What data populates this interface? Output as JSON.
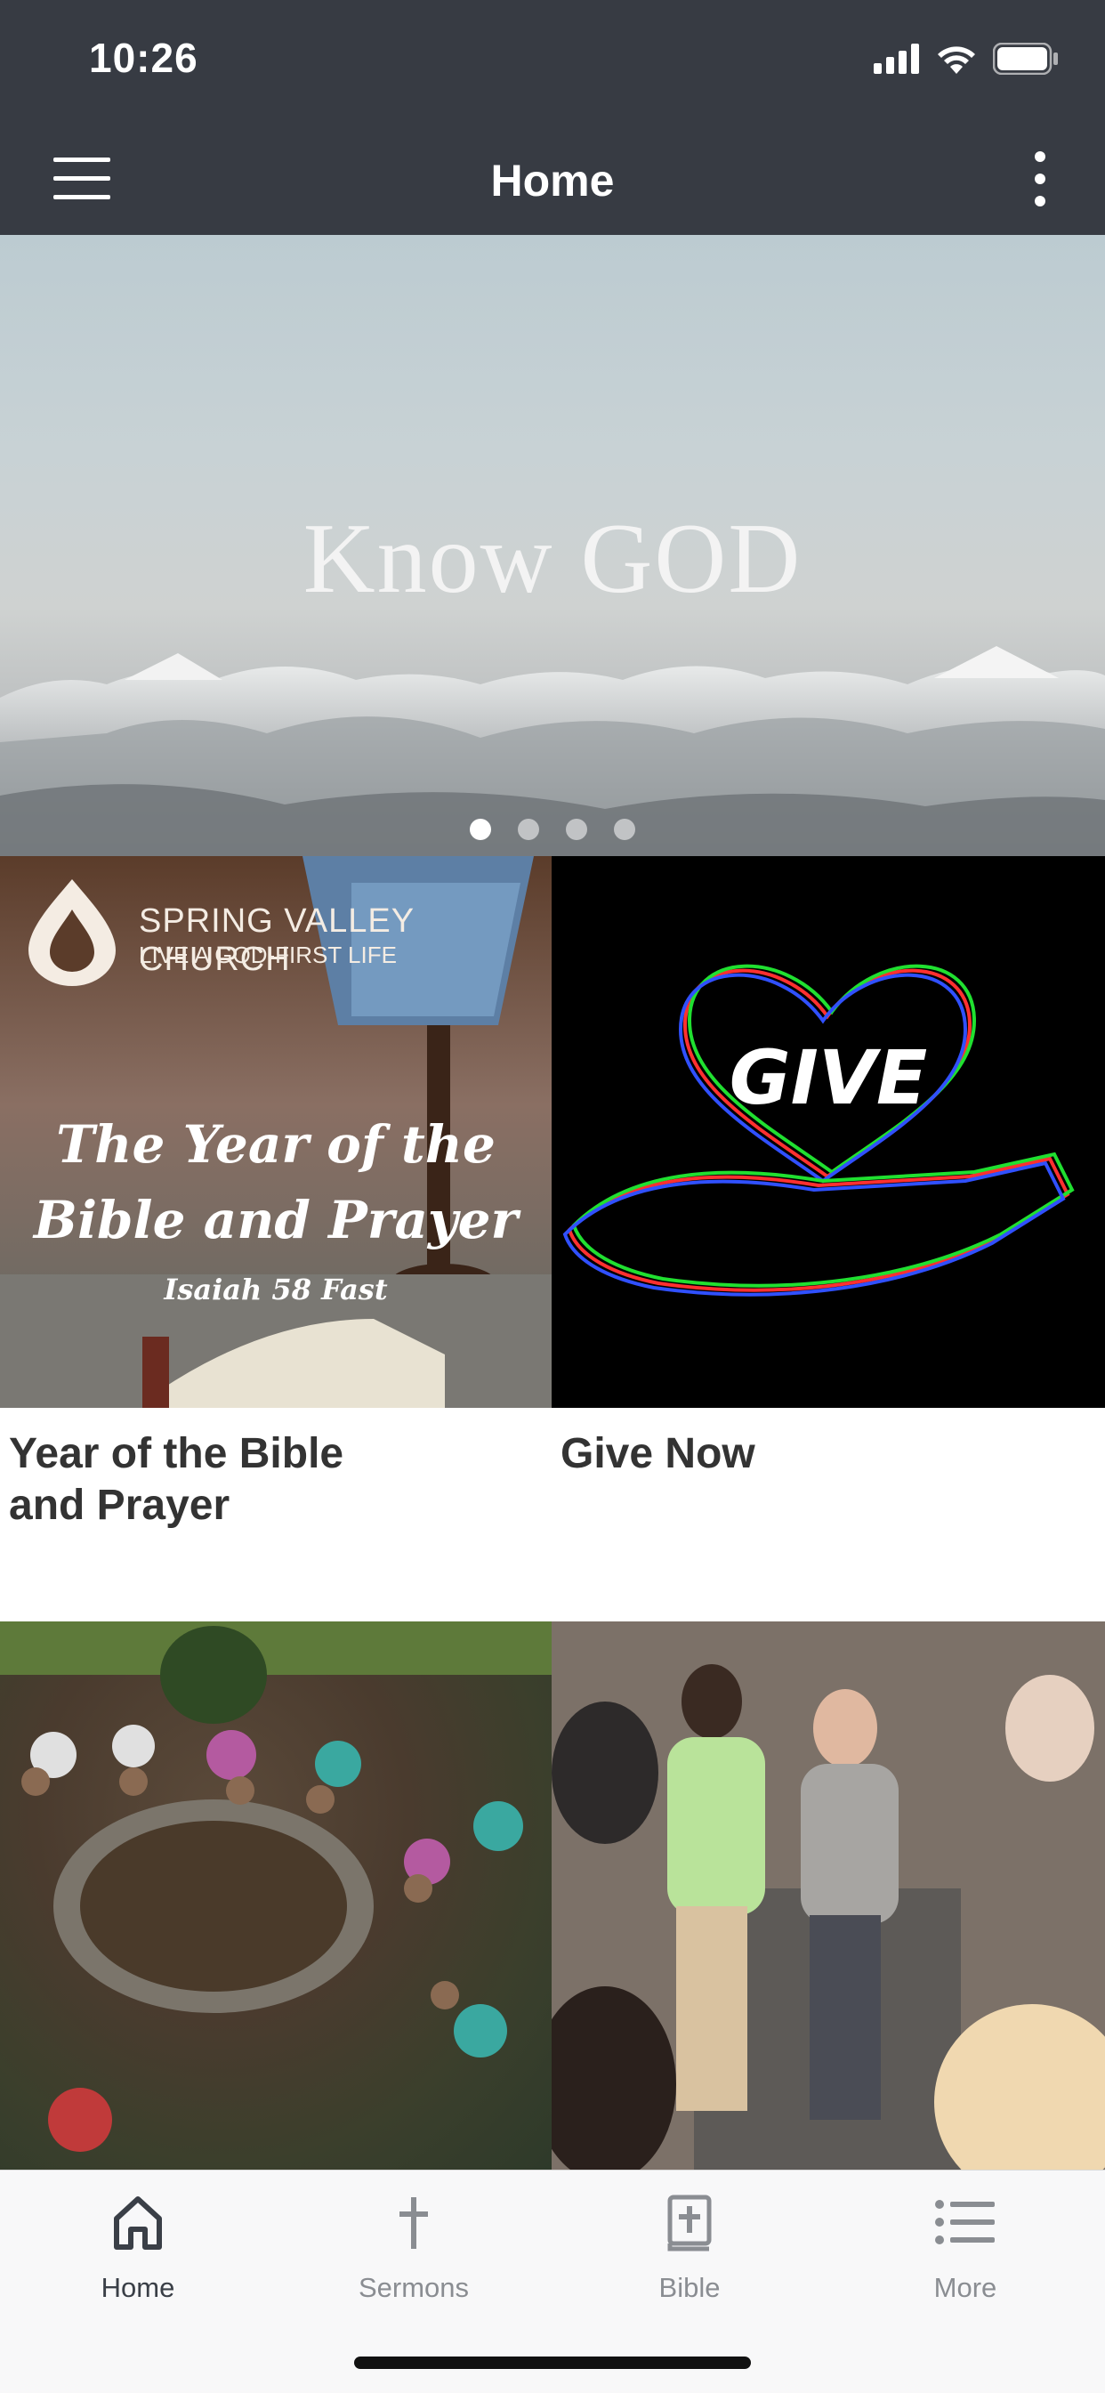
{
  "status_bar": {
    "time": "10:26"
  },
  "nav": {
    "title": "Home"
  },
  "hero": {
    "title": "Know GOD",
    "pages": 4,
    "active_page": 1
  },
  "tiles": [
    {
      "label": "Year of the Bible and Prayer",
      "image_text": {
        "church": "SPRING VALLEY CHURCH",
        "tagline": "LIVE A GOD-FIRST LIFE",
        "headline_line1": "The Year of the",
        "headline_line2": "Bible and Prayer",
        "subtitle": "Isaiah 58 Fast"
      }
    },
    {
      "label": "Give Now",
      "image_text": {
        "word": "GIVE"
      }
    },
    {
      "label": ""
    },
    {
      "label": ""
    }
  ],
  "tabs": [
    {
      "label": "Home",
      "icon": "home-icon",
      "active": true
    },
    {
      "label": "Sermons",
      "icon": "cross-icon",
      "active": false
    },
    {
      "label": "Bible",
      "icon": "bible-icon",
      "active": false
    },
    {
      "label": "More",
      "icon": "list-icon",
      "active": false
    }
  ],
  "colors": {
    "header_bg": "#373b43",
    "tab_active": "#3a3f47",
    "tab_inactive": "#8a8d92"
  }
}
